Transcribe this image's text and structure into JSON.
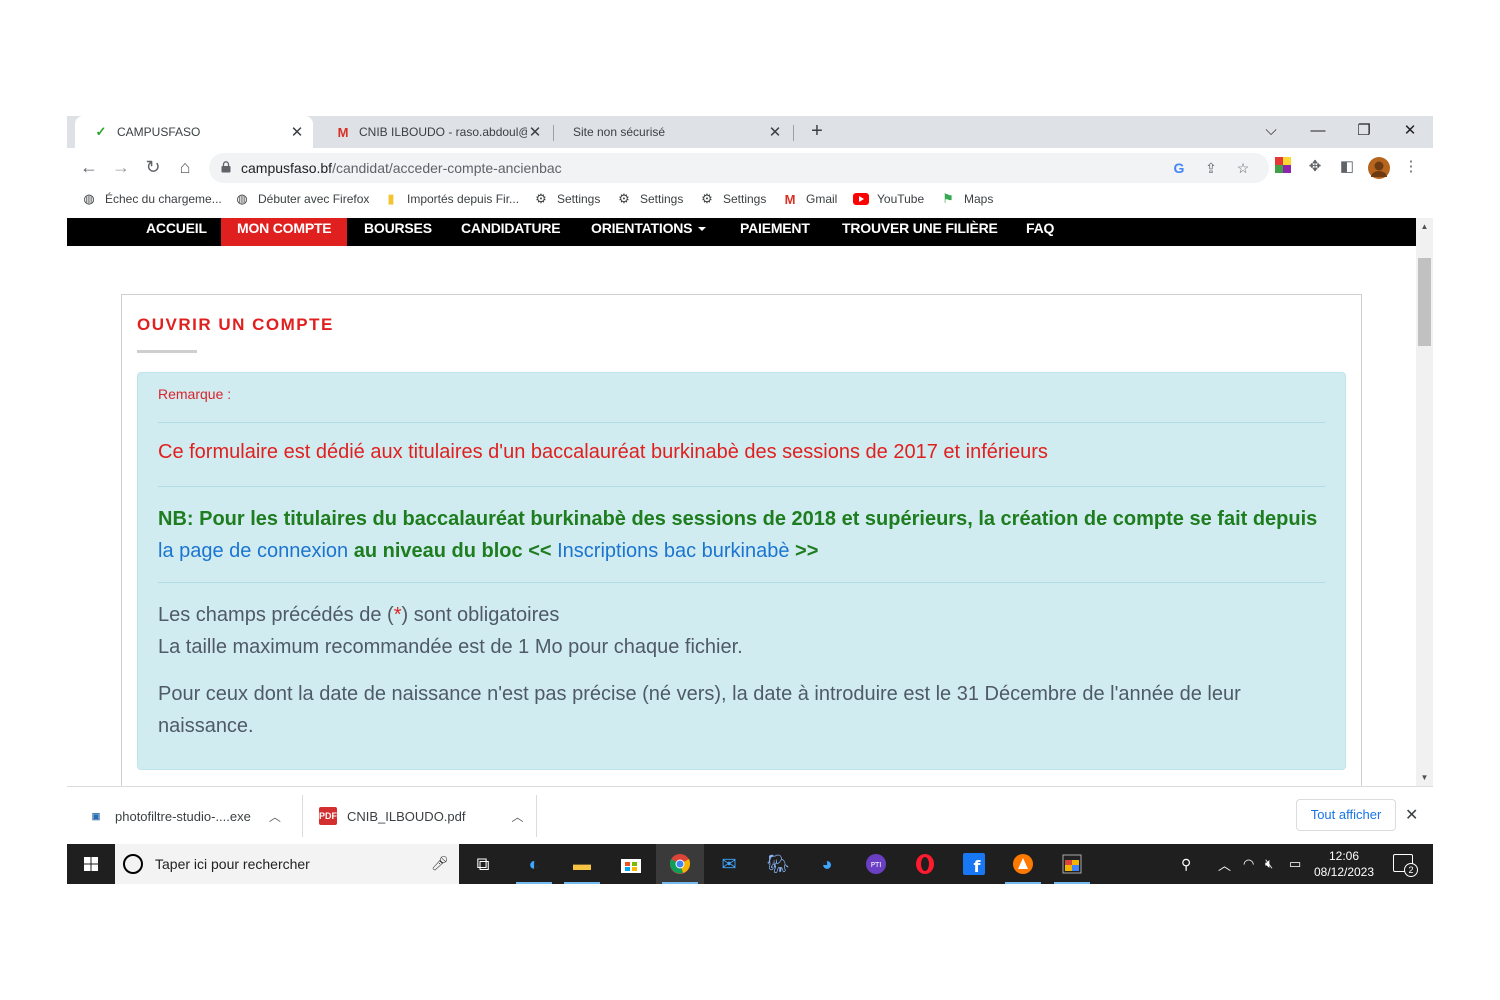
{
  "browser": {
    "tabs": [
      {
        "title": "CAMPUSFASO",
        "active": true
      },
      {
        "title": "CNIB ILBOUDO - raso.abdoul@gm",
        "active": false
      },
      {
        "title": "Site non sécurisé",
        "active": false
      }
    ],
    "url_domain": "campusfaso.bf",
    "url_path": "/candidat/acceder-compte-ancienbac",
    "bookmarks": [
      {
        "label": "Échec du chargeme...",
        "icon": "globe-icon"
      },
      {
        "label": "Débuter avec Firefox",
        "icon": "globe-icon"
      },
      {
        "label": "Importés depuis Fir...",
        "icon": "folder-icon"
      },
      {
        "label": "Settings",
        "icon": "gear-icon"
      },
      {
        "label": "Settings",
        "icon": "gear-icon"
      },
      {
        "label": "Settings",
        "icon": "gear-icon"
      },
      {
        "label": "Gmail",
        "icon": "gmail-icon"
      },
      {
        "label": "YouTube",
        "icon": "youtube-icon"
      },
      {
        "label": "Maps",
        "icon": "maps-icon"
      }
    ]
  },
  "site": {
    "nav": [
      "ACCUEIL",
      "MON COMPTE",
      "BOURSES",
      "CANDIDATURE",
      "ORIENTATIONS",
      "PAIEMENT",
      "TROUVER UNE FILIÈRE",
      "FAQ"
    ],
    "active_nav": "MON COMPTE",
    "panel_title": "OUVRIR UN COMPTE",
    "alert": {
      "remark": "Remarque :",
      "red_line": "Ce formulaire est dédié aux titulaires d'un baccalauréat burkinabè des sessions de 2017 et inférieurs",
      "nb_part1": "NB: Pour les titulaires du baccalauréat burkinabè des sessions de 2018 et supérieurs, la création de compte se fait depuis",
      "nb_link1": "la page de connexion",
      "nb_part2": "au niveau du bloc <<",
      "nb_link2": "Inscriptions bac burkinabè",
      "nb_part3": ">>",
      "required_pre": "Les champs précédés de (",
      "required_star": "*",
      "required_post": ") sont obligatoires",
      "max_size": "La taille maximum recommandée est de 1 Mo pour chaque fichier.",
      "birth_note": "Pour ceux dont la date de naissance n'est pas précise (né vers), la date à introduire est le 31 Décembre de l'année de leur naissance."
    }
  },
  "downloads": {
    "items": [
      {
        "name": "photofiltre-studio-....exe"
      },
      {
        "name": "CNIB_ILBOUDO.pdf"
      }
    ],
    "show_all": "Tout afficher"
  },
  "taskbar": {
    "search_placeholder": "Taper ici pour rechercher",
    "time": "12:06",
    "date": "08/12/2023",
    "notifications": "2"
  },
  "colors": {
    "accent_red": "#e0201f",
    "alert_bg": "#d1ecf1",
    "green_text": "#1e7d1e",
    "link_blue": "#1b75d0"
  }
}
